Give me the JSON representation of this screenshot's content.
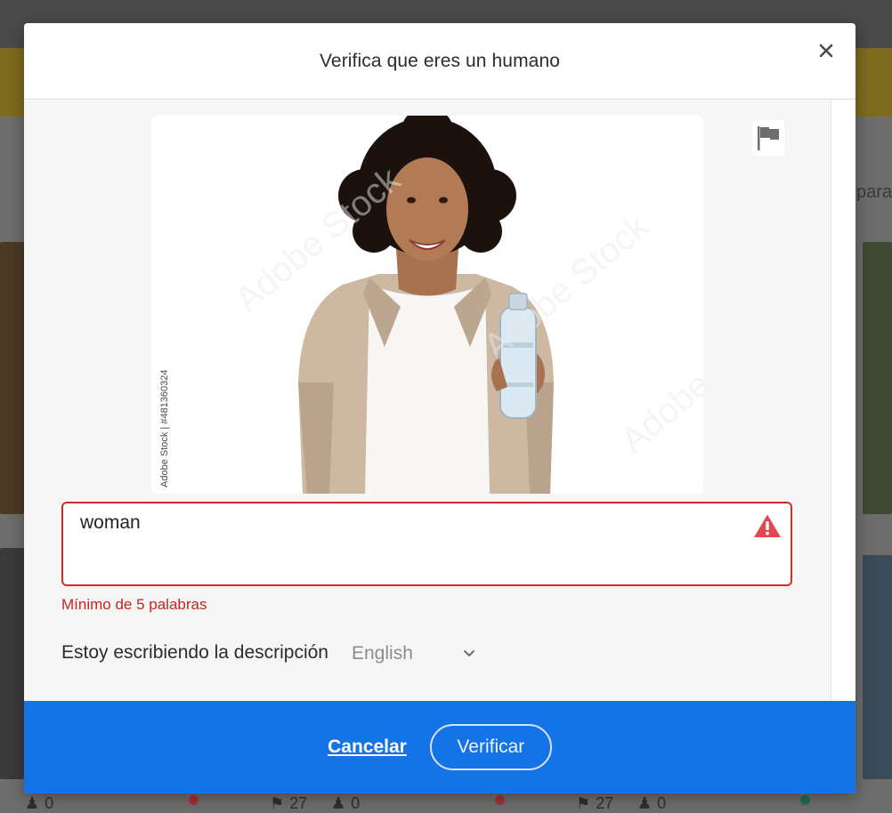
{
  "modal": {
    "title": "Verifica que eres un humano",
    "description_value": "woman",
    "error_text": "Mínimo de 5 palabras",
    "language_label": "Estoy escribiendo la descripción",
    "language_selected": "English",
    "cancel_label": "Cancelar",
    "verify_label": "Verificar",
    "image": {
      "watermark_text": "Adobe Stock",
      "credit_text": "Adobe Stock | #481360324"
    }
  },
  "background": {
    "partial_text": "para",
    "stats": [
      {
        "icon": "users-icon",
        "value": "0"
      },
      {
        "icon": "tag-icon",
        "value": "27"
      },
      {
        "icon": "users-icon",
        "value": "0"
      },
      {
        "icon": "tag-icon",
        "value": "27"
      },
      {
        "icon": "users-icon",
        "value": "0"
      }
    ]
  },
  "colors": {
    "accent": "#1473e6",
    "error": "#c62323",
    "warning": "#e34850",
    "status_red": "#d7373f",
    "status_green": "#2d9d78"
  }
}
